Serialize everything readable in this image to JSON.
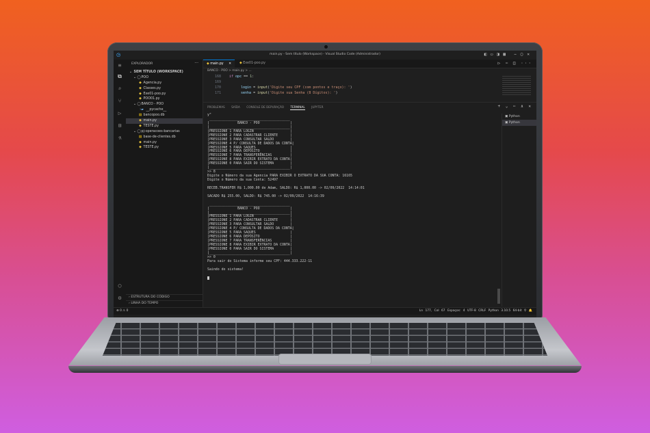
{
  "window": {
    "title": "main.py - Sem título (Workspace) - Visual Studio Code (Administrador)",
    "layout_icons": "◧ ▭ ◨ ▦",
    "controls": [
      "−",
      "▢",
      "✕"
    ]
  },
  "sidebar": {
    "header": "EXPLORADOR",
    "more": "···",
    "items": [
      {
        "indent": 0,
        "icon": "v",
        "label": "SEM TÍTULO (WORKSPACE)"
      },
      {
        "indent": 1,
        "icon": "v ◯",
        "label": "POO"
      },
      {
        "indent": 2,
        "icon": "py",
        "label": "Agencia.py"
      },
      {
        "indent": 2,
        "icon": "py",
        "label": "Classes.py"
      },
      {
        "indent": 2,
        "icon": "py",
        "label": "Exe01-poo.py"
      },
      {
        "indent": 2,
        "icon": "py",
        "label": "POO01.py"
      },
      {
        "indent": 1,
        "icon": "v ◯",
        "label": "BANCO - POO"
      },
      {
        "indent": 2,
        "icon": "> folder",
        "label": "__pycache__"
      },
      {
        "indent": 2,
        "icon": "db",
        "label": "bancopoo.db"
      },
      {
        "indent": 2,
        "icon": "py",
        "label": "main.py",
        "selected": true
      },
      {
        "indent": 2,
        "icon": "py",
        "label": "TESTE.py"
      },
      {
        "indent": 1,
        "icon": "v ◯",
        "label": "pj-operacoes-bancarias"
      },
      {
        "indent": 2,
        "icon": "db",
        "label": "base-de-clientes.db"
      },
      {
        "indent": 2,
        "icon": "py",
        "label": "main.py"
      },
      {
        "indent": 2,
        "icon": "py",
        "label": "TESTE.py"
      }
    ],
    "footer": [
      "ESTRUTURA DO CÓDIGO",
      "LINHA DO TEMPO"
    ]
  },
  "tabs": [
    {
      "label": "main.py",
      "close": "✕",
      "active": true
    },
    {
      "label": "Exe01-poo.py",
      "active": false
    }
  ],
  "tab_actions": "▷ ⋯ ◫ ···",
  "breadcrumb": "BANCO - POO > main.py > ...",
  "code_lines": [
    {
      "num": "168",
      "text": "if opc == 1:"
    },
    {
      "num": "169",
      "text": ""
    },
    {
      "num": "170",
      "text": "login = input('Digite seu CPF (com pontos e traço): ')"
    },
    {
      "num": "171",
      "text": "senha = input('Digite sua Senha (8 Dígitos): ')"
    }
  ],
  "panel": {
    "tabs": [
      "PROBLEMAS",
      "SAÍDA",
      "CONSOLE DE DEPURAÇÃO",
      "TERMINAL",
      "JUPYTER"
    ],
    "active_tab": "TERMINAL",
    "controls": "+ ⌄  ⋯  ∧  ✕",
    "terminals": [
      "Python",
      "Python"
    ],
    "terminal_lines": [
      "y\"",
      " ________________________________________",
      "|              BANCO - POO               |",
      "|________________________________________|",
      "|PRESSIONE 1 PARA LOGIN                  |",
      "|PRESSIONE 2 PARA CADASTRAR CLIENTE      |",
      "|PRESSIONE 3 PARA CONSULTAR SALDO        |",
      "|PRESSIONE 4 P/ CONSULTA DE DADOS DA CONTA|",
      "|PRESSIONE 5 PARA SAQUES                 |",
      "|PRESSIONE 6 PARA DEPÓSITO               |",
      "|PRESSIONE 7 PARA TRANSFERÊNCIAS         |",
      "|PRESSIONE 8 PARA EXIBIR EXTRATO DA CONTA|",
      "|PRESSIONE 0 PARA SAIR DO SISTEMA        |",
      "|________________________________________|",
      ">> 8",
      "Digite o Número da sua Agencia PARA EXIBIR O EXTRATO DA SUA CONTA: 16165",
      "Digite o Número da sua Conta: 52497",
      "",
      "RECEB.TRANSFER R$ 1,000.00 de Adam, SALDO: R$ 1,000.00 -> 02/09/2022  14:14:01",
      "",
      "SACADO R$ 255.00, SALDO: R$ 745.00 -> 02/09/2022  14:16:39",
      "",
      " ________________________________________",
      "|              BANCO - POO               |",
      "|________________________________________|",
      "|PRESSIONE 1 PARA LOGIN                  |",
      "|PRESSIONE 2 PARA CADASTRAR CLIENTE      |",
      "|PRESSIONE 3 PARA CONSULTAR SALDO        |",
      "|PRESSIONE 4 P/ CONSULTA DE DADOS DA CONTA|",
      "|PRESSIONE 5 PARA SAQUES                 |",
      "|PRESSIONE 6 PARA DEPÓSITO               |",
      "|PRESSIONE 7 PARA TRANSFERÊNCIAS         |",
      "|PRESSIONE 8 PARA EXIBIR EXTRATO DA CONTA|",
      "|PRESSIONE 0 PARA SAIR DO SISTEMA        |",
      "|________________________________________|",
      ">> 0",
      "Para sair do Sistema informe seu CPF: 444.333.222-11",
      "",
      "Saindo do sistema!",
      ""
    ]
  },
  "statusbar": {
    "left": "⊗ 0 ⚠ 0",
    "right": "Ln 177, Col 67   Espaços: 4   UTF-8   CRLF   Python   3.10.5 64-bit   ⚲   🔔"
  },
  "colors": {
    "background_top": "#f0611f",
    "background_bottom": "#cf5ee0",
    "vscode_bg": "#1e1e1e",
    "accent": "#0078d4"
  }
}
